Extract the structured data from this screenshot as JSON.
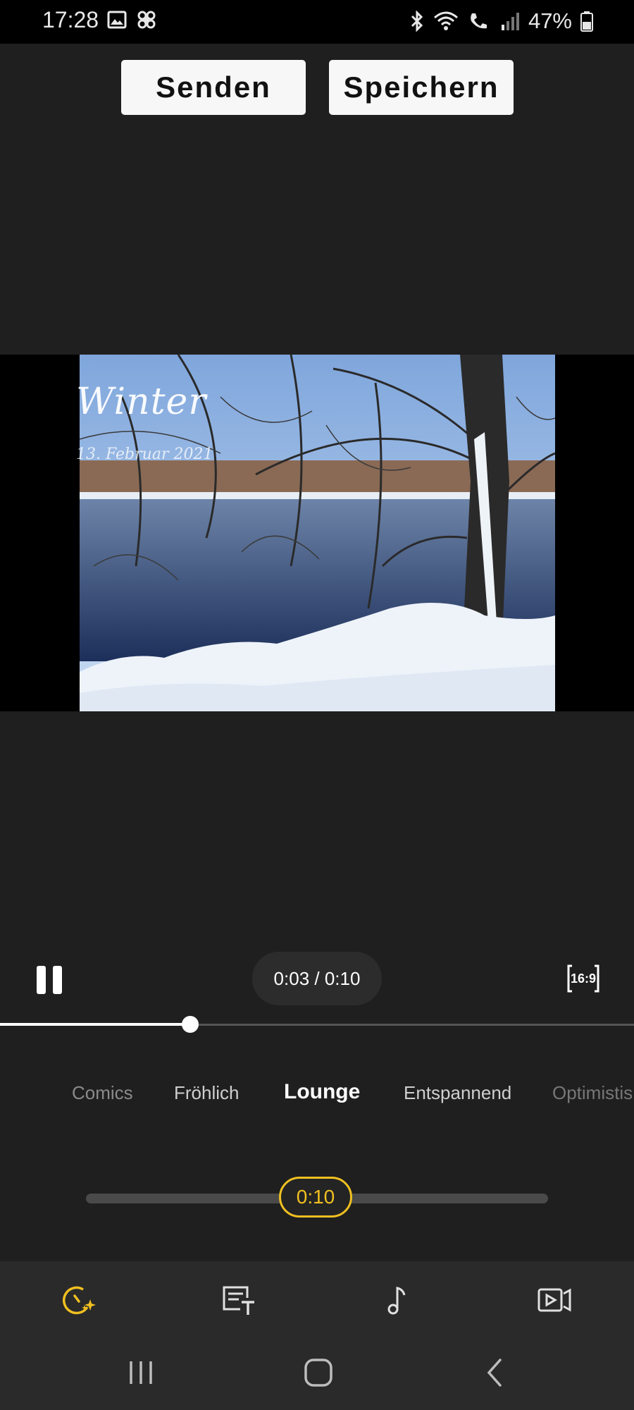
{
  "status_bar": {
    "time": "17:28",
    "battery": "47%",
    "icons": [
      "image-icon",
      "pinwheel-icon",
      "bluetooth-icon",
      "wifi-icon",
      "wifi-call-icon",
      "signal-icon",
      "battery-icon"
    ]
  },
  "actions": {
    "send_label": "Senden",
    "save_label": "Speichern"
  },
  "preview": {
    "overlay_title": "Winter",
    "overlay_date": "13. Februar 2021"
  },
  "player": {
    "time_display": "0:03 / 0:10",
    "aspect_ratio": "16:9",
    "progress_fraction": 0.3
  },
  "moods": [
    {
      "label": "Comics"
    },
    {
      "label": "Fröhlich"
    },
    {
      "label": "Lounge",
      "selected": true
    },
    {
      "label": "Entspannend"
    },
    {
      "label": "Optimistis"
    }
  ],
  "duration": {
    "value": "0:10"
  },
  "toolbar": {
    "items": [
      "speed-effects-icon",
      "text-icon",
      "music-icon",
      "video-clip-icon"
    ]
  },
  "colors": {
    "accent": "#f0c020",
    "background": "#1f1f1f"
  }
}
